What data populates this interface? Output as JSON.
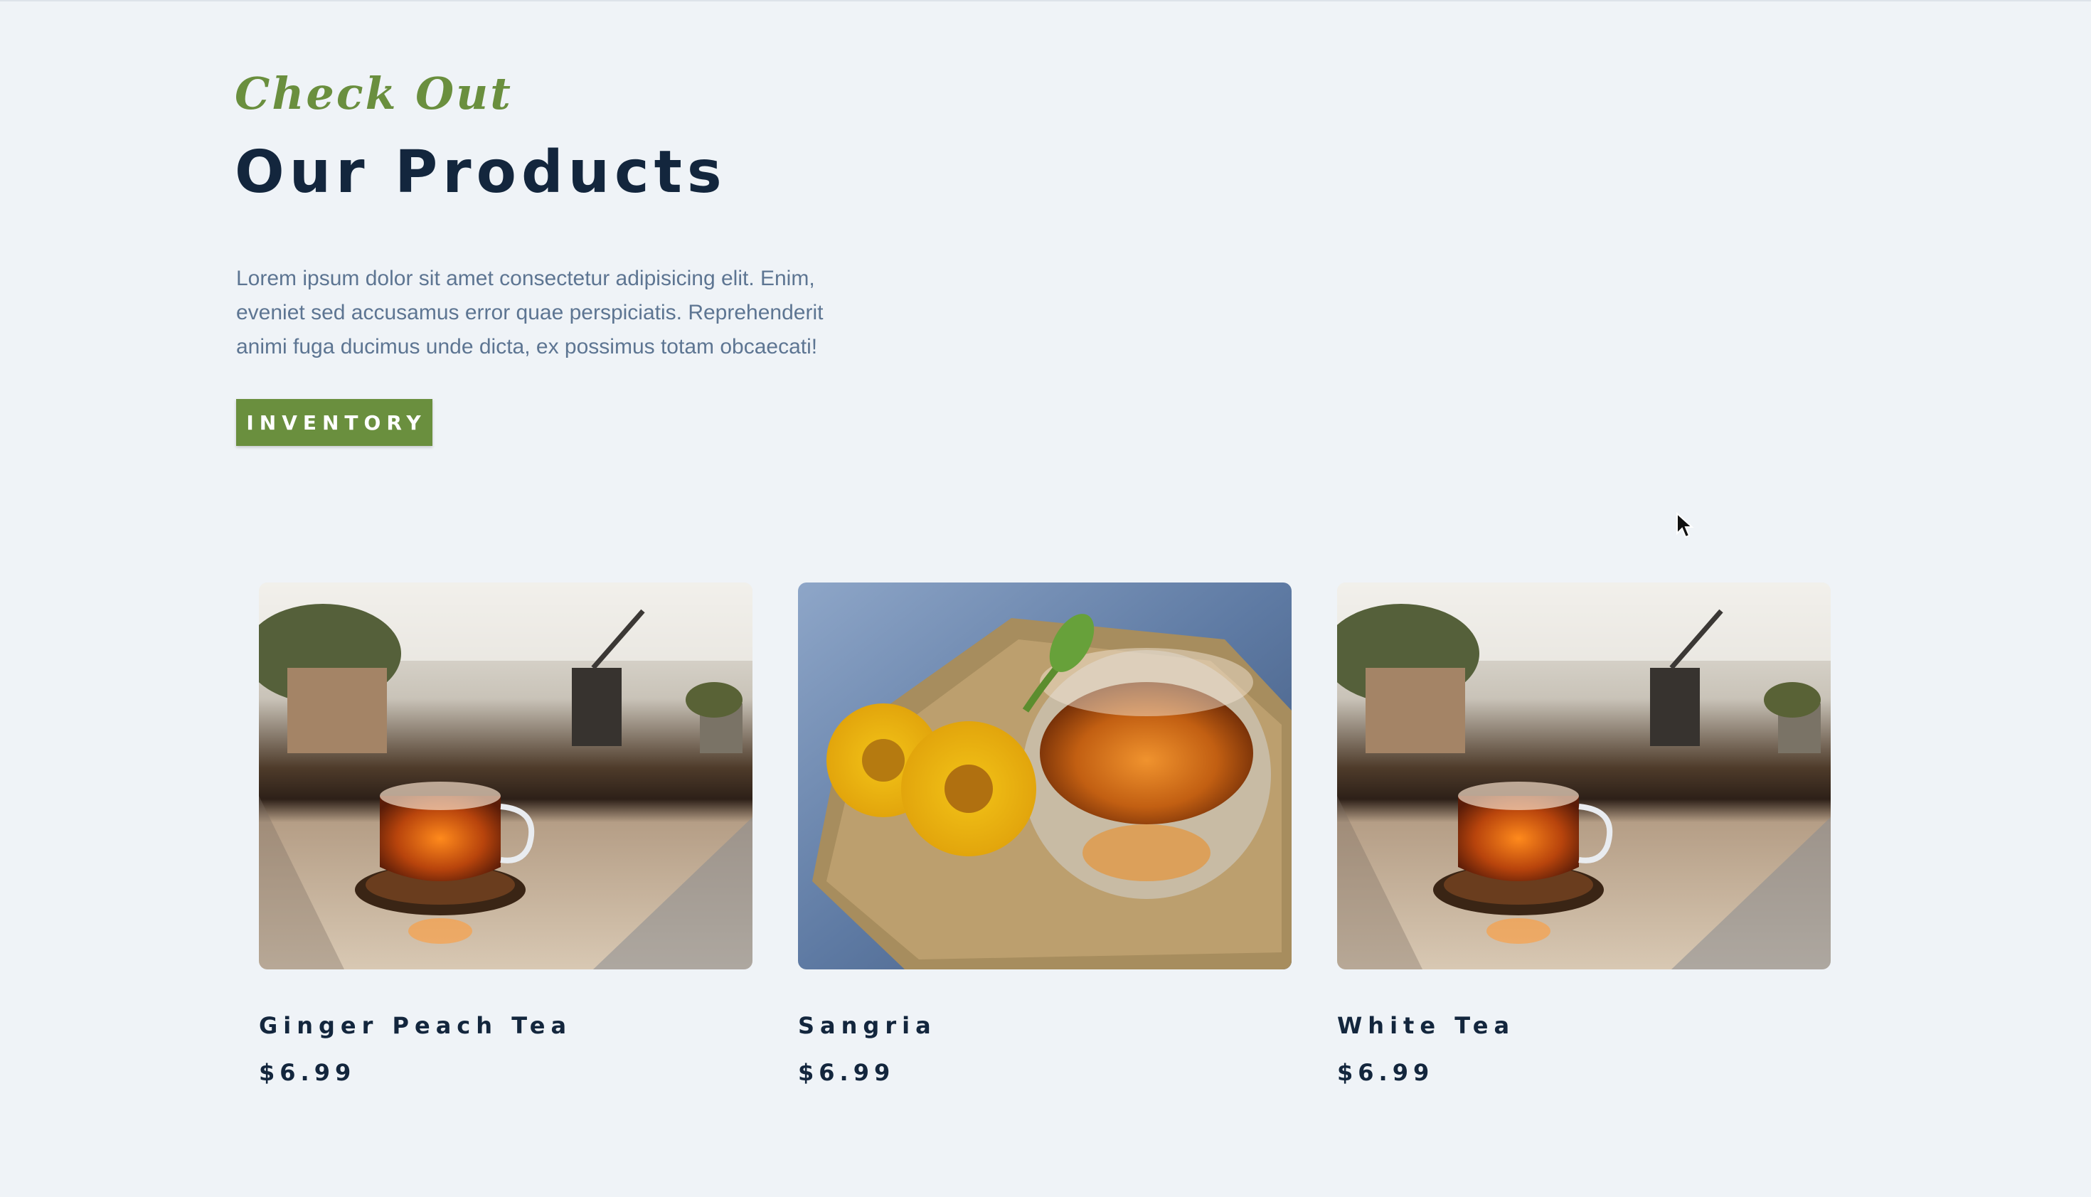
{
  "hero": {
    "eyebrow": "Check Out",
    "title": "Our Products",
    "description": "Lorem ipsum dolor sit amet consectetur adipisicing elit. Enim, eveniet sed accusamus error quae perspiciatis. Reprehenderit animi fuga ducimus unde dicta, ex possimus totam obcaecati!",
    "button_label": "INVENTORY"
  },
  "products": [
    {
      "name": "Ginger Peach Tea",
      "price": "$6.99",
      "image": "tea-cup-on-table-photo"
    },
    {
      "name": "Sangria",
      "price": "$6.99",
      "image": "tea-bowl-with-flowers-photo"
    },
    {
      "name": "White Tea",
      "price": "$6.99",
      "image": "tea-cup-on-table-photo"
    }
  ],
  "colors": {
    "background": "#eff3f7",
    "accent_green": "#6a8f3e",
    "heading_navy": "#13263d",
    "body_text": "#5d7592"
  }
}
